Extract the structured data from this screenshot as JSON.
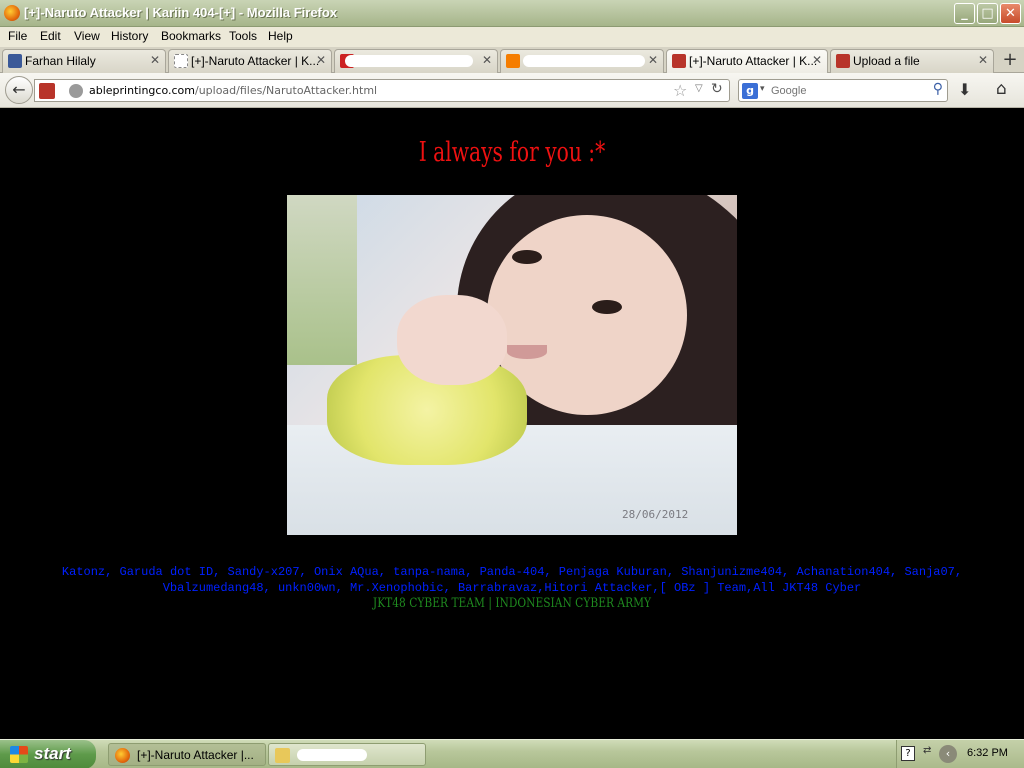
{
  "window": {
    "title": "[+]-Naruto Attacker | Kariin 404-[+] - Mozilla Firefox",
    "controls": {
      "minimize": "_",
      "maximize": "□",
      "close": "✕"
    }
  },
  "menu": [
    "File",
    "Edit",
    "View",
    "History",
    "Bookmarks",
    "Tools",
    "Help"
  ],
  "tabs": [
    {
      "label": "Farhan Hilaly",
      "icon": "facebook-icon",
      "icon_color": "#3b5998"
    },
    {
      "label": "[+]-Naruto Attacker | K...",
      "icon": "blank-page-icon",
      "icon_color": "#ffffff"
    },
    {
      "label": "",
      "icon": "gmail-icon",
      "icon_color": "#cc2222"
    },
    {
      "label": "",
      "icon": "blogger-icon",
      "icon_color": "#f57d00"
    },
    {
      "label": "[+]-Naruto Attacker | K...",
      "icon": "site-icon",
      "icon_color": "#b8342a"
    },
    {
      "label": "Upload a file",
      "icon": "site-icon",
      "icon_color": "#b8342a"
    }
  ],
  "tab_close_glyph": "✕",
  "new_tab_glyph": "+",
  "navbar": {
    "back_glyph": "←",
    "url_domain": "ableprintingco.com",
    "url_path": "/upload/files/NarutoAttacker.html",
    "star_glyph": "☆",
    "dropdown_glyph": "▽",
    "reload_glyph": "↻",
    "search_engine_glyph": "g",
    "search_dropdown_glyph": "▾",
    "search_placeholder": "Google",
    "search_glyph": "⚲",
    "download_glyph": "⬇",
    "home_glyph": "⌂"
  },
  "page": {
    "heading": "I always for you :*",
    "photo_date": "28/06/2012",
    "thanks_line1": "Katonz, Garuda dot ID, Sandy-x207, Onix AQua, tanpa-nama, Panda-404, Penjaga Kuburan, Shanjunizme404, Achanation404, Sanja07,",
    "thanks_line2": "Vbalzumedang48, unkn00wn, Mr.Xenophobic, Barrabravaz,Hitori Attacker,[ OBz ] Team,All JKT48 Cyber",
    "team": "JKT48 CYBER TEAM | INDONESIAN CYBER ARMY"
  },
  "colors": {
    "heading": "#ee1111",
    "thanks": "#0020ff",
    "team": "#1f8a1f",
    "background": "#000000"
  },
  "taskbar": {
    "start_label": "start",
    "items": [
      {
        "label": "[+]-Naruto Attacker |...",
        "icon": "firefox-icon",
        "active": true
      },
      {
        "label": "",
        "icon": "folder-icon",
        "active": false
      }
    ],
    "help_glyph": "?",
    "network_glyph": "⇄",
    "tray_arrow_glyph": "‹",
    "clock": "6:32 PM"
  }
}
